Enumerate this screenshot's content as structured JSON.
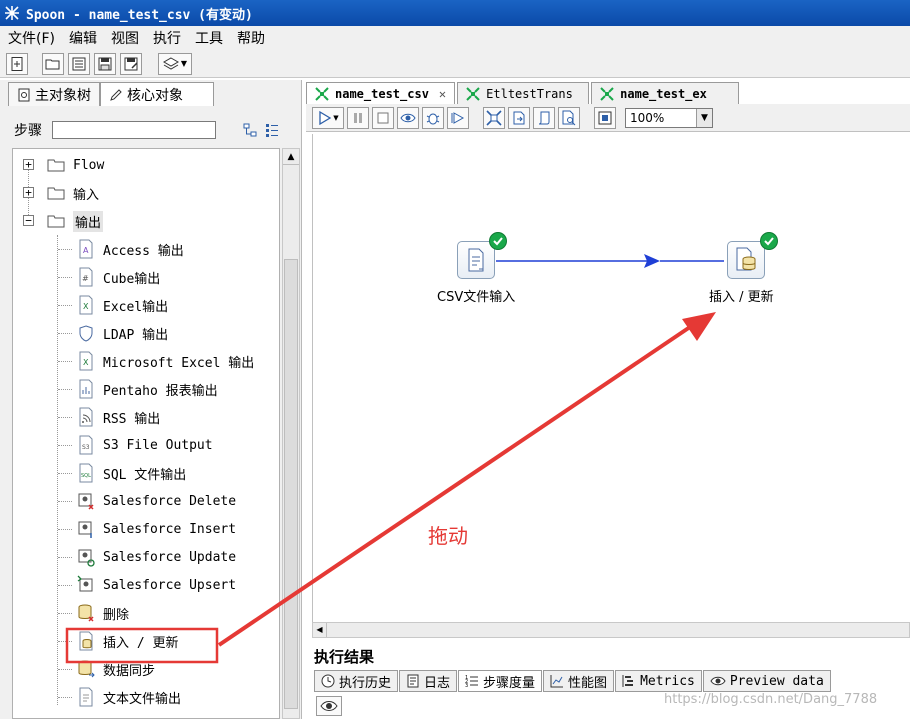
{
  "window": {
    "title": "Spoon - name_test_csv (有变动)"
  },
  "menu": [
    "文件(F)",
    "编辑",
    "视图",
    "执行",
    "工具",
    "帮助"
  ],
  "left_panel": {
    "tabs": [
      {
        "label": "主对象树",
        "icon": "document-icon"
      },
      {
        "label": "核心对象",
        "icon": "pencil-icon"
      }
    ],
    "steps_label": "步骤",
    "search_value": "",
    "tree": {
      "folders": [
        {
          "label": "Flow",
          "expanded": false
        },
        {
          "label": "输入",
          "expanded": false
        },
        {
          "label": "输出",
          "expanded": true
        }
      ],
      "output_items": [
        "Access 输出",
        "Cube输出",
        "Excel输出",
        "LDAP 输出",
        "Microsoft Excel 输出",
        "Pentaho 报表输出",
        "RSS 输出",
        "S3 File Output",
        "SQL 文件输出",
        "Salesforce Delete",
        "Salesforce Insert",
        "Salesforce Update",
        "Salesforce Upsert",
        "删除",
        "插入 / 更新",
        "数据同步",
        "文本文件输出"
      ]
    }
  },
  "editor": {
    "tabs": [
      {
        "label": "name_test_csv",
        "active": true,
        "closable": true
      },
      {
        "label": "EtltestTrans",
        "active": false
      },
      {
        "label": "name_test_ex",
        "active": false
      }
    ],
    "zoom": "100%",
    "steps": [
      {
        "label": "CSV文件输入",
        "status": "ok"
      },
      {
        "label": "插入 / 更新",
        "status": "ok"
      }
    ],
    "annotation": "拖动"
  },
  "results": {
    "title": "执行结果",
    "tabs": [
      "执行历史",
      "日志",
      "步骤度量",
      "性能图",
      "Metrics",
      "Preview data"
    ],
    "active_tab": "步骤度量"
  },
  "watermark": "https://blog.csdn.net/Dang_7788",
  "colors": {
    "titlebar": "#0b4aa8",
    "hop": "#1f3fd6",
    "annotation": "#e53935",
    "ok": "#1aa84a"
  }
}
